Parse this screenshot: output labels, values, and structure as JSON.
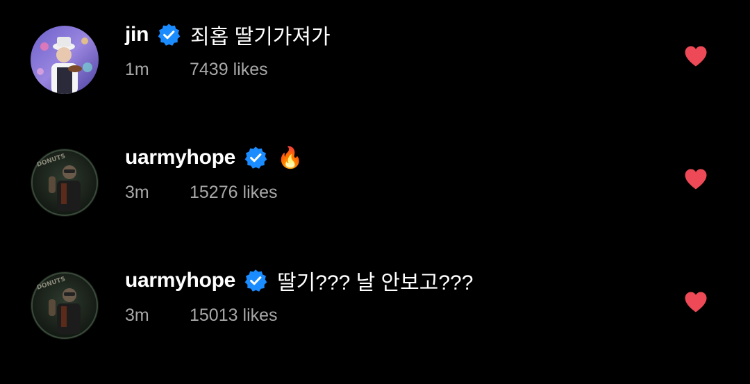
{
  "comments": [
    {
      "username": "jin",
      "text": "죄홉 딸기가져가",
      "time": "1m",
      "like_count": "7439",
      "likes_word": "likes",
      "verified": true,
      "liked": true
    },
    {
      "username": "uarmyhope",
      "text": "🔥",
      "time": "3m",
      "like_count": "15276",
      "likes_word": "likes",
      "verified": true,
      "liked": true
    },
    {
      "username": "uarmyhope",
      "text": "딸기??? 날 안보고???",
      "time": "3m",
      "like_count": "15013",
      "likes_word": "likes",
      "verified": true,
      "liked": true
    }
  ],
  "colors": {
    "background": "#000000",
    "verified_badge": "#1a8cff",
    "heart": "#ed4956",
    "meta_text": "#a8a8a8"
  },
  "icons": {
    "verified": "verified-badge-icon",
    "like": "heart-filled-icon",
    "fire": "fire-emoji"
  }
}
